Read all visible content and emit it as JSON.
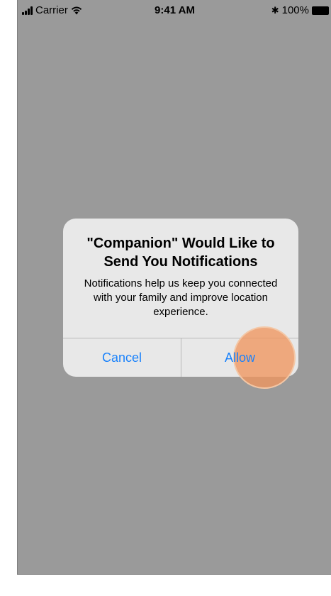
{
  "status_bar": {
    "carrier": "Carrier",
    "time": "9:41 AM",
    "bluetooth": "✱",
    "battery": "100%"
  },
  "alert": {
    "title": "\"Companion\" Would Like to Send You Notifications",
    "message": "Notifications help us keep you connected with your family and improve location experience.",
    "cancel_label": "Cancel",
    "allow_label": "Allow"
  },
  "colors": {
    "background": "#9a9a9a",
    "alert_background": "#e8e8e8",
    "button_text": "#1a82fb",
    "tap_highlight": "#f0965f"
  },
  "icons": [
    "signal-icon",
    "wifi-icon",
    "bluetooth-icon",
    "battery-icon"
  ]
}
